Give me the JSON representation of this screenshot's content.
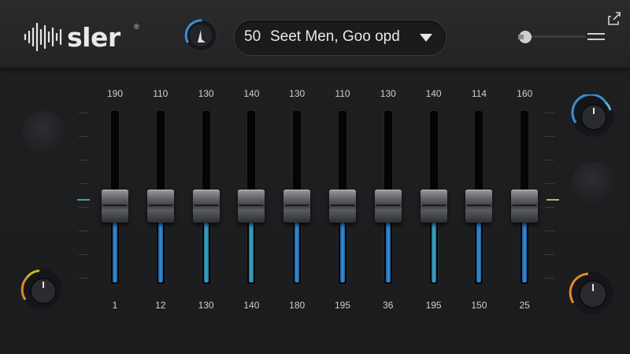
{
  "app": {
    "logo_text": "sler",
    "logo_mark": "®"
  },
  "header": {
    "preset_number": "50",
    "preset_name": "Seet Men, Goo opd"
  },
  "bands": [
    {
      "top": "190",
      "bottom": "1",
      "level": 0.45,
      "color": "blue"
    },
    {
      "top": "110",
      "bottom": "12",
      "level": 0.45,
      "color": "blue"
    },
    {
      "top": "130",
      "bottom": "130",
      "level": 0.45,
      "color": "teal"
    },
    {
      "top": "140",
      "bottom": "140",
      "level": 0.45,
      "color": "teal"
    },
    {
      "top": "130",
      "bottom": "180",
      "level": 0.45,
      "color": "blue"
    },
    {
      "top": "110",
      "bottom": "195",
      "level": 0.45,
      "color": "blue"
    },
    {
      "top": "130",
      "bottom": "36",
      "level": 0.45,
      "color": "blue"
    },
    {
      "top": "140",
      "bottom": "195",
      "level": 0.45,
      "color": "teal"
    },
    {
      "top": "114",
      "bottom": "150",
      "level": 0.45,
      "color": "blue"
    },
    {
      "top": "160",
      "bottom": "25",
      "level": 0.45,
      "color": "blue"
    }
  ],
  "colors": {
    "accent_blue": "#3a8fd4",
    "accent_teal": "#3ea7c9",
    "knob_orange": "#e08a2a",
    "knob_yellow": "#c9b52a",
    "marker_left": "#4a9fa9",
    "marker_right": "#a7c04a"
  },
  "icons": [
    "logo-waveform-icon",
    "mode-knob-icon",
    "dropdown-caret-icon",
    "volume-icon",
    "menu-icon",
    "export-icon"
  ]
}
